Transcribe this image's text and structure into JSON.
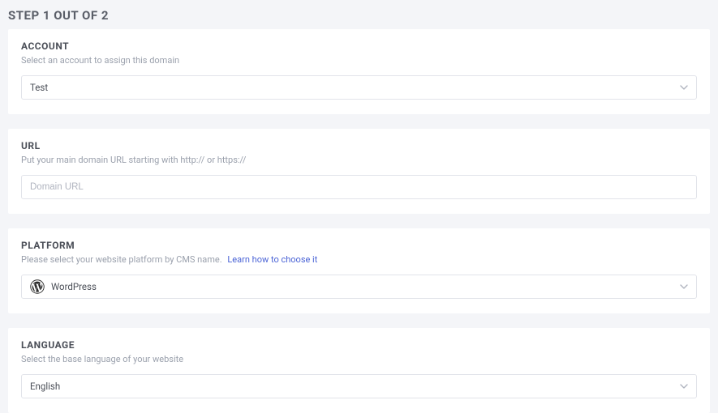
{
  "pageTitle": "STEP 1 OUT OF 2",
  "account": {
    "title": "ACCOUNT",
    "subtitle": "Select an account to assign this domain",
    "value": "Test"
  },
  "url": {
    "title": "URL",
    "subtitle": "Put your main domain URL starting with http:// or https://",
    "placeholder": "Domain URL"
  },
  "platform": {
    "title": "PLATFORM",
    "subtitle": "Please select your website platform by CMS name.",
    "link": "Learn how to choose it",
    "value": "WordPress"
  },
  "language": {
    "title": "LANGUAGE",
    "subtitle": "Select the base language of your website",
    "value": "English"
  }
}
